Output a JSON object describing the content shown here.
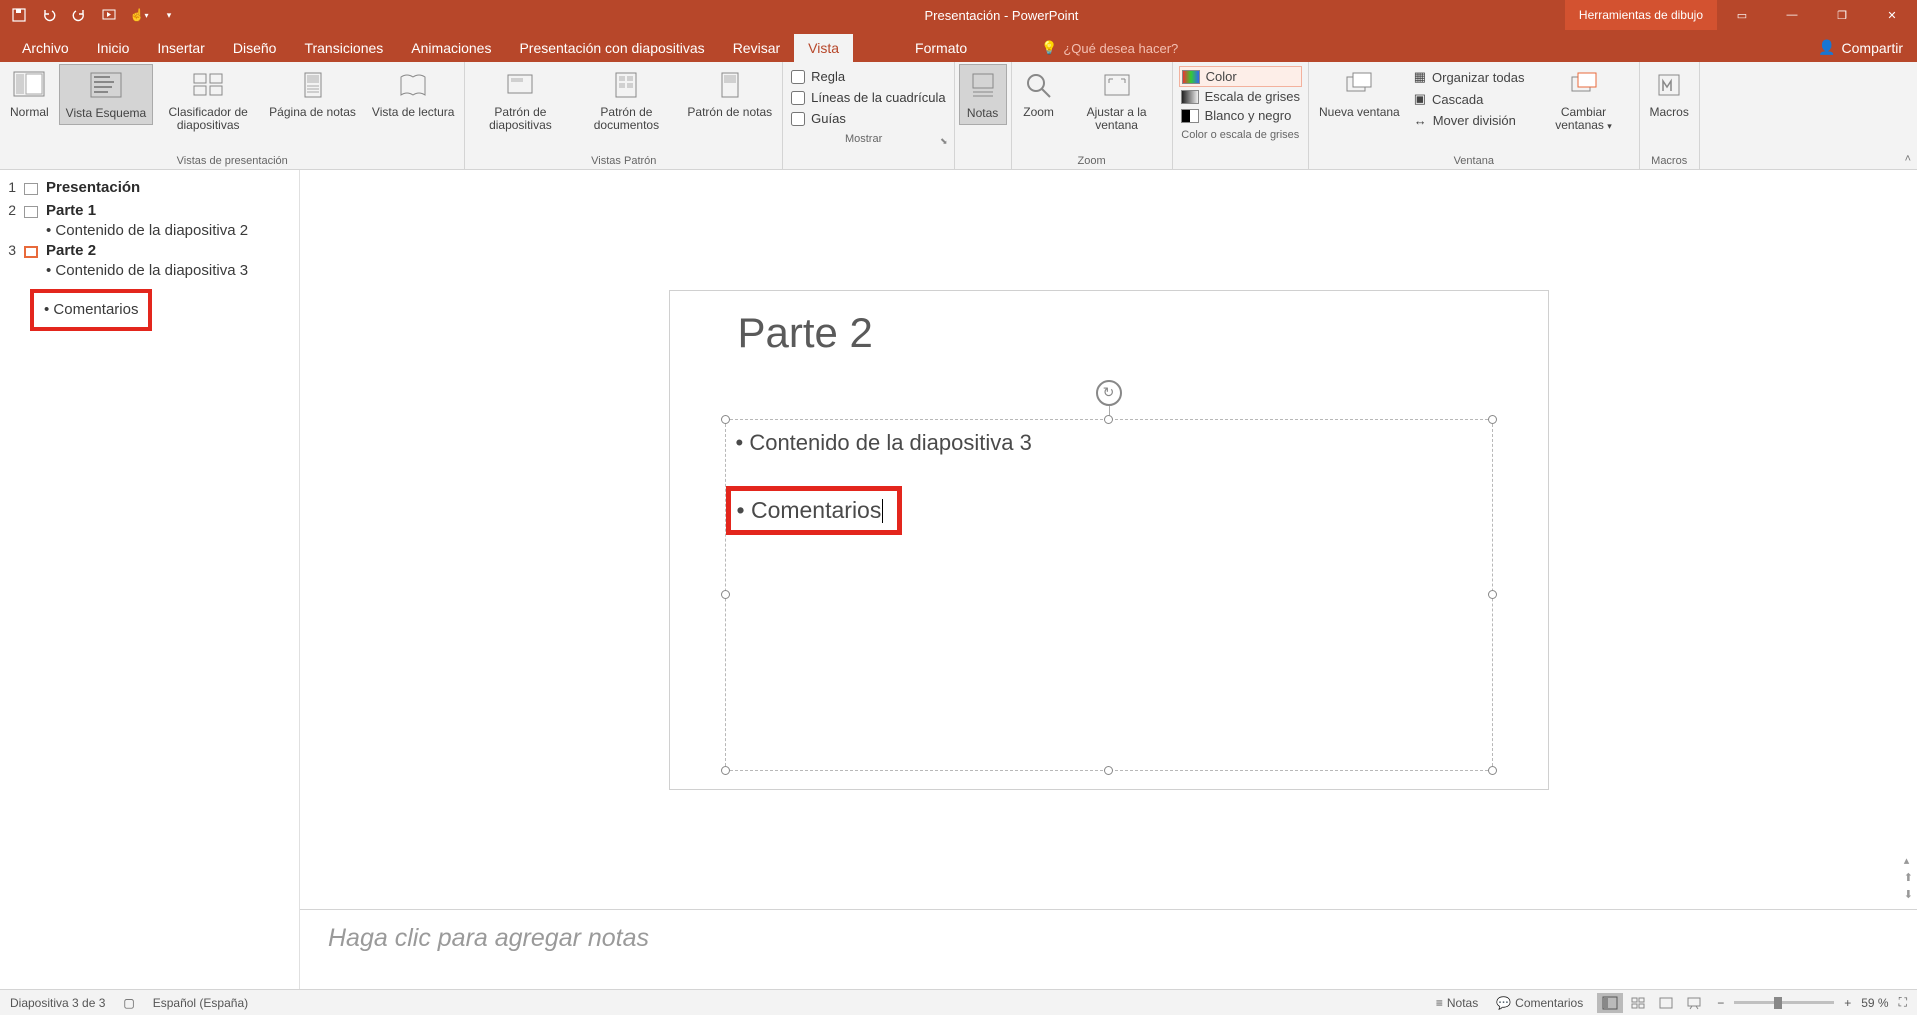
{
  "app": {
    "title": "Presentación - PowerPoint",
    "tools_tab": "Herramientas de dibujo"
  },
  "window_controls": {
    "ribbon_display": "▭",
    "minimize": "—",
    "restore": "❐",
    "close": "✕"
  },
  "tabs": {
    "file": "Archivo",
    "home": "Inicio",
    "insert": "Insertar",
    "design": "Diseño",
    "transitions": "Transiciones",
    "animations": "Animaciones",
    "slideshow": "Presentación con diapositivas",
    "review": "Revisar",
    "view": "Vista",
    "format": "Formato",
    "tell_me": "¿Qué desea hacer?",
    "share": "Compartir"
  },
  "ribbon": {
    "views": {
      "normal": "Normal",
      "outline": "Vista Esquema",
      "sorter": "Clasificador de diapositivas",
      "notes_page": "Página de notas",
      "reading": "Vista de lectura",
      "group": "Vistas de presentación"
    },
    "masters": {
      "slide": "Patrón de diapositivas",
      "handout": "Patrón de documentos",
      "notes": "Patrón de notas",
      "group": "Vistas Patrón"
    },
    "show": {
      "ruler": "Regla",
      "gridlines": "Líneas de la cuadrícula",
      "guides": "Guías",
      "group": "Mostrar"
    },
    "notes_btn": "Notas",
    "zoom": {
      "zoom": "Zoom",
      "fit": "Ajustar a la ventana",
      "group": "Zoom"
    },
    "color": {
      "color": "Color",
      "grayscale": "Escala de grises",
      "bw": "Blanco y negro",
      "group": "Color o escala de grises"
    },
    "window": {
      "new": "Nueva ventana",
      "arrange": "Organizar todas",
      "cascade": "Cascada",
      "split": "Mover división",
      "switch": "Cambiar ventanas",
      "group": "Ventana"
    },
    "macros": {
      "label": "Macros",
      "group": "Macros"
    }
  },
  "outline": {
    "slide1": {
      "num": "1",
      "title": "Presentación"
    },
    "slide2": {
      "num": "2",
      "title": "Parte 1",
      "content1": "Contenido de la diapositiva 2"
    },
    "slide3": {
      "num": "3",
      "title": "Parte 2",
      "content1": "Contenido de la diapositiva 3",
      "content2": "Comentarios"
    }
  },
  "slide": {
    "title": "Parte 2",
    "bullet1": "Contenido de la diapositiva 3",
    "bullet2": "Comentarios"
  },
  "notes": {
    "placeholder": "Haga clic para agregar notas"
  },
  "statusbar": {
    "slide_info": "Diapositiva 3 de 3",
    "language": "Español (España)",
    "notes": "Notas",
    "comments": "Comentarios",
    "zoom": "59 %"
  }
}
